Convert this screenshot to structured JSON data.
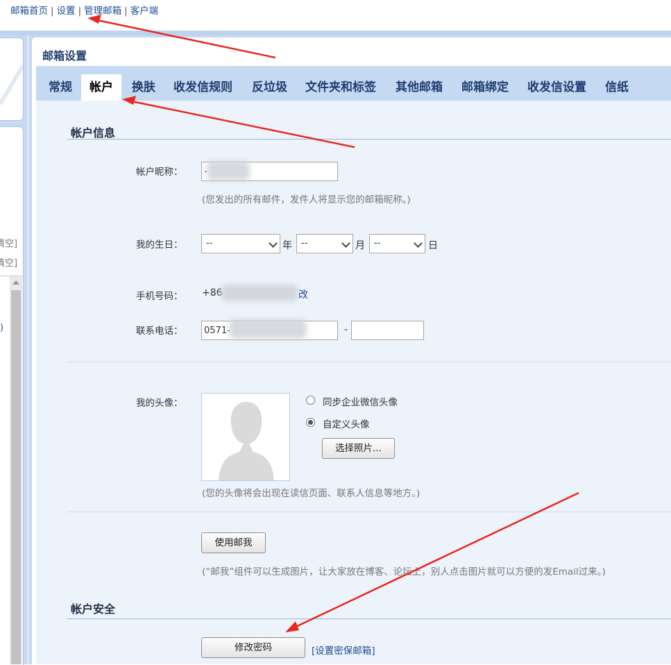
{
  "topnav": {
    "items": [
      "邮箱首页",
      "设置",
      "管理邮箱",
      "客户端"
    ],
    "separator": "|"
  },
  "sidebar": {
    "clear_links": [
      "清空]",
      "清空]"
    ],
    "paren": ")"
  },
  "main": {
    "title": "邮箱设置",
    "tabs": [
      "常规",
      "帐户",
      "换肤",
      "收发信规则",
      "反垃圾",
      "文件夹和标签",
      "其他邮箱",
      "邮箱绑定",
      "收发信设置",
      "信纸"
    ],
    "active_tab": "帐户"
  },
  "account_info": {
    "section_title": "帐户信息",
    "nickname_label": "帐户昵称：",
    "nickname_value": "-",
    "nickname_hint": "(您发出的所有邮件，发件人将显示您的邮箱昵称。)",
    "birthday_label": "我的生日：",
    "year_value": "--",
    "month_value": "--",
    "day_value": "--",
    "year_unit": "年",
    "month_unit": "月",
    "day_unit": "日",
    "mobile_label": "手机号码：",
    "mobile_prefix": "+86",
    "mobile_change_link": "改",
    "phone_label": "联系电话：",
    "phone_value": "0571-",
    "phone_dash": "-",
    "ext_value": "",
    "avatar_label": "我的头像：",
    "avatar_option_sync": "同步企业微信头像",
    "avatar_option_custom": "自定义头像",
    "choose_photo_button": "选择照片...",
    "avatar_hint": "(您的头像将会出现在读信页面、联系人信息等地方。)",
    "use_mailme_button": "使用邮我",
    "mailme_hint": "(“邮我”组件可以生成图片，让大家放在博客、论坛上，别人点击图片就可以方便的发Email过来。)"
  },
  "account_security": {
    "section_title": "帐户安全",
    "change_password_button": "修改密码",
    "set_security_email_link": "[设置密保邮箱]"
  },
  "colors": {
    "accent_blue": "#c5daf2",
    "content_bg": "#edf3fb",
    "link": "#1a4e96",
    "annotation_arrow": "#e8281e"
  }
}
